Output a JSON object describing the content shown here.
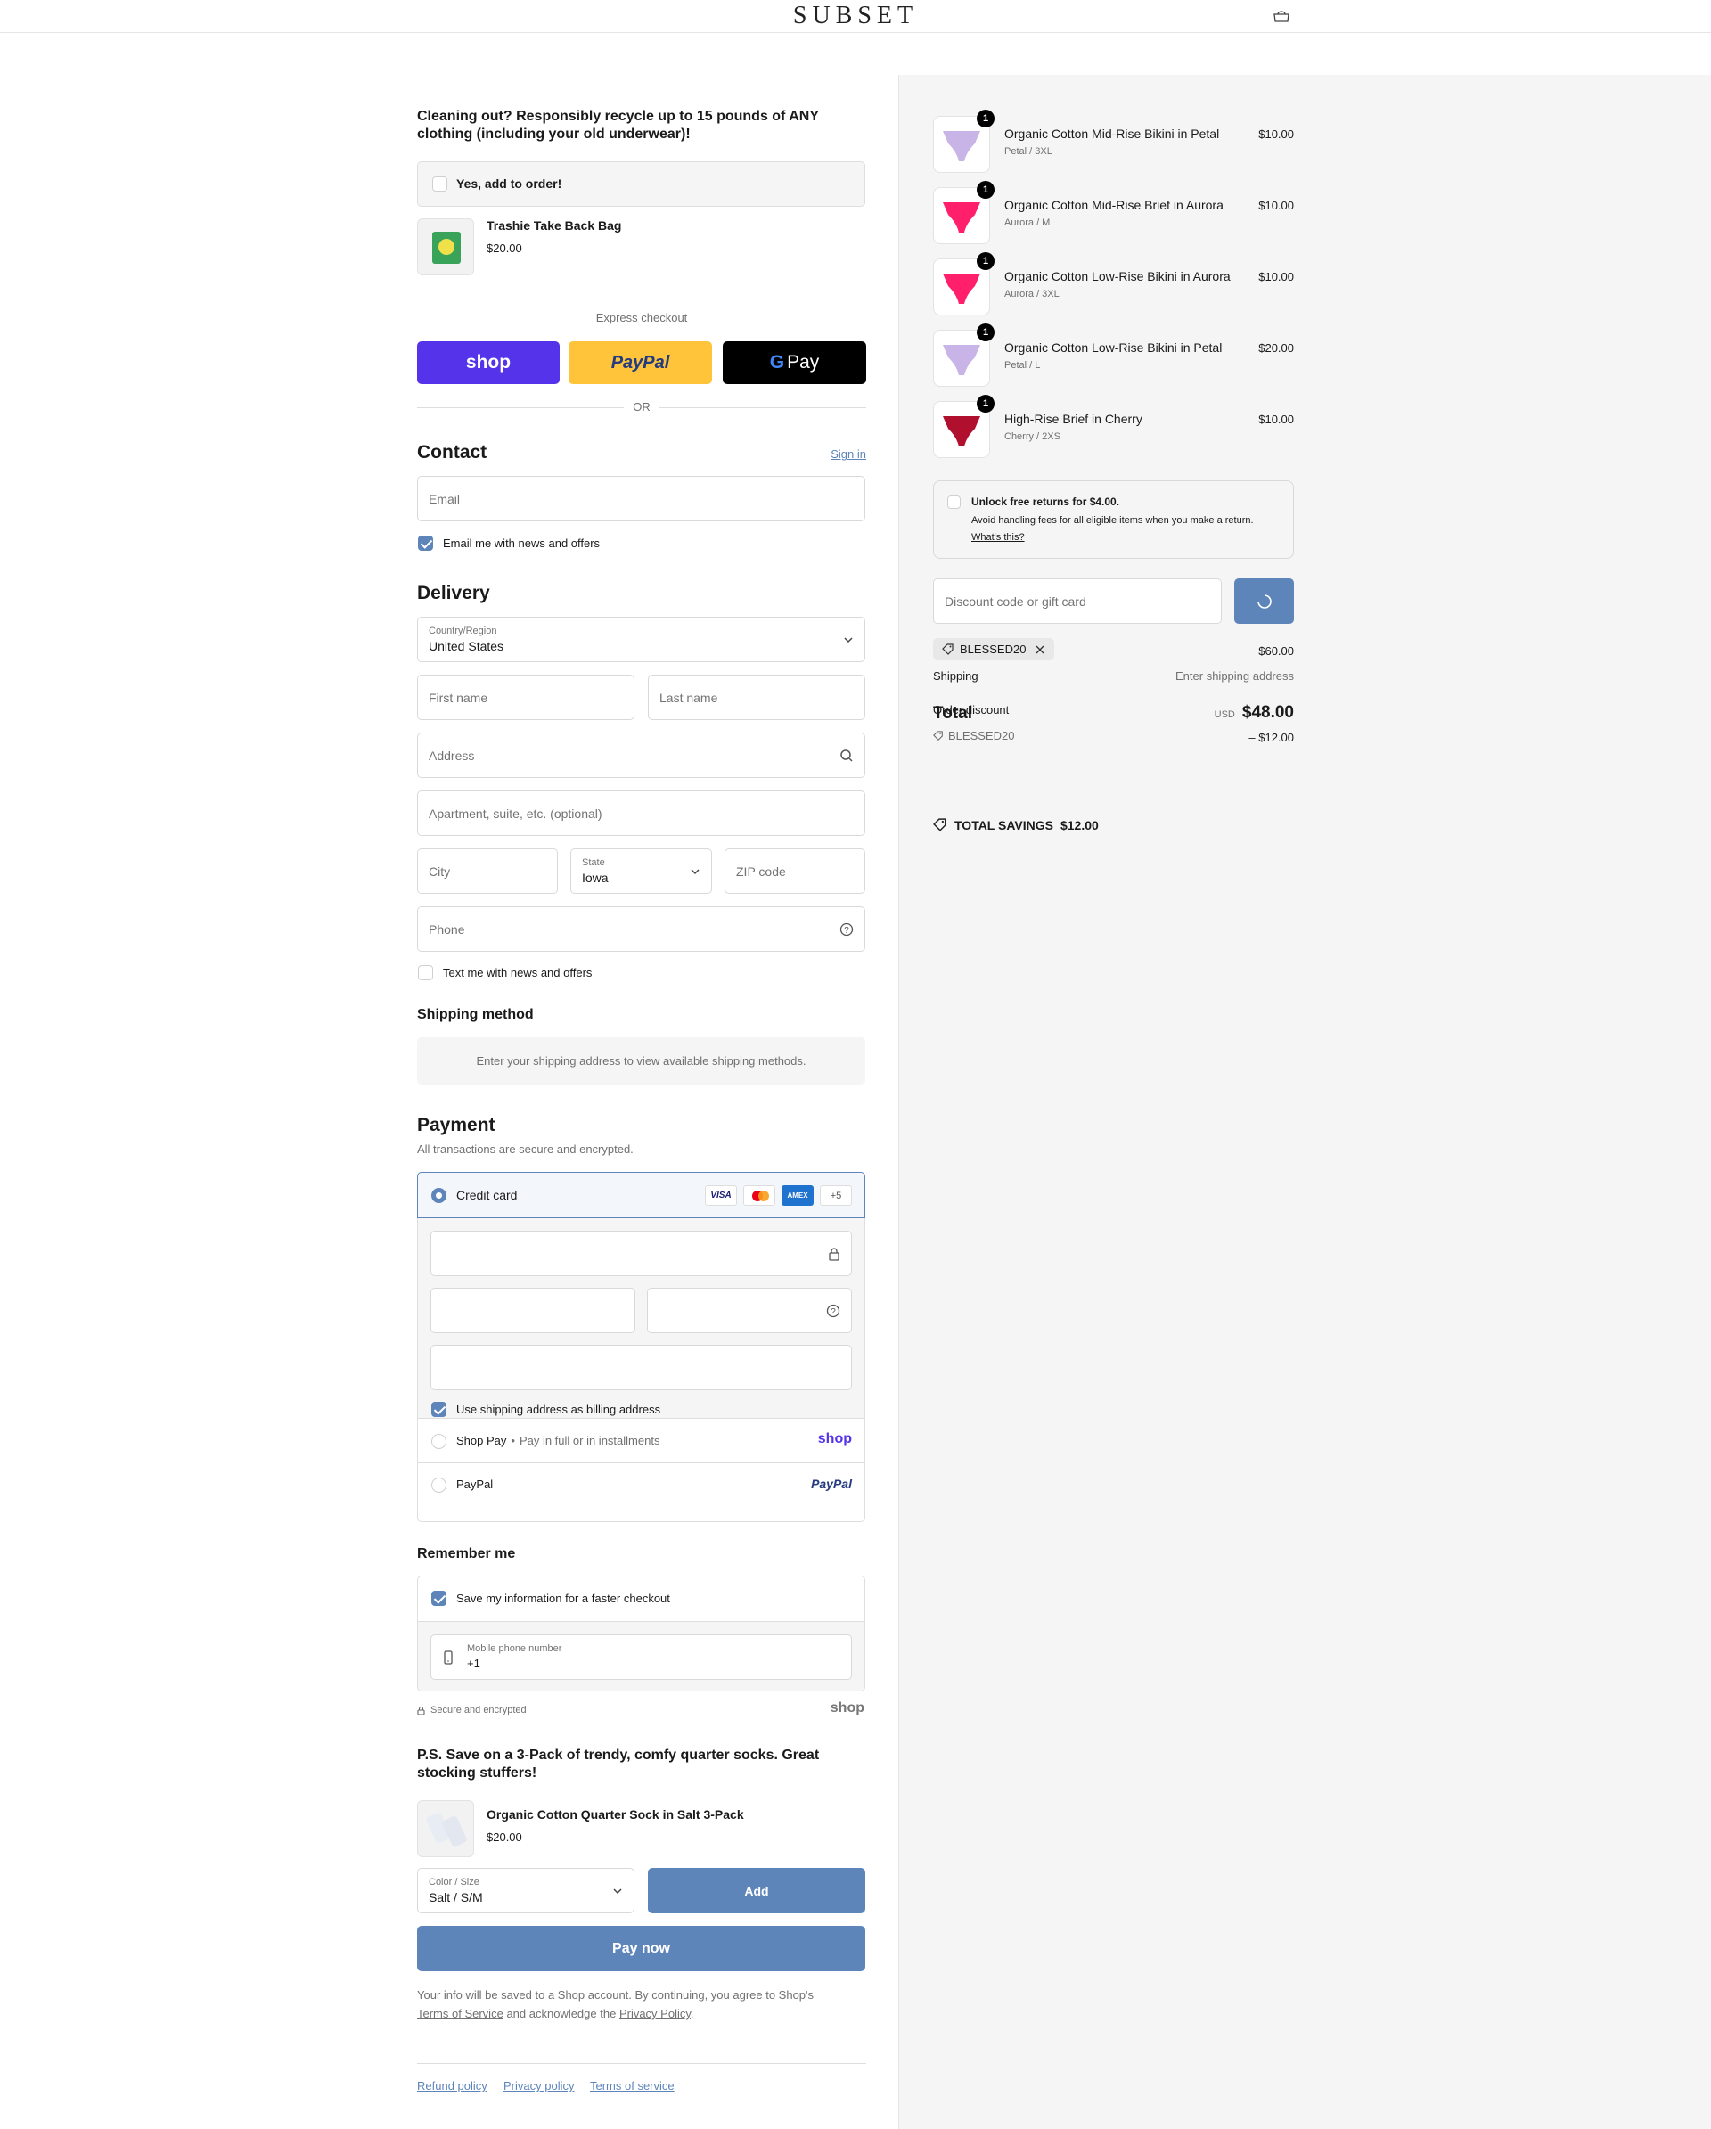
{
  "header": {
    "logo": "SUBSET",
    "cart_icon": "shopping-bag-icon"
  },
  "recycle": {
    "title": "Cleaning out? Responsibly recycle up to 15 pounds of ANY clothing (including your old underwear)!",
    "add_label": "Yes, add to order!",
    "product_name": "Trashie Take Back Bag",
    "product_price": "$20.00"
  },
  "express": {
    "label": "Express checkout",
    "shop_label": "shop",
    "paypal_label": "PayPal",
    "gpay_label": "Pay",
    "or_label": "OR"
  },
  "contact": {
    "title": "Contact",
    "sign_in": "Sign in",
    "email_placeholder": "Email",
    "email_news_label": "Email me with news and offers",
    "email_news_checked": true
  },
  "delivery": {
    "title": "Delivery",
    "country_label": "Country/Region",
    "country_value": "United States",
    "first_name_placeholder": "First name",
    "last_name_placeholder": "Last name",
    "address_placeholder": "Address",
    "apartment_placeholder": "Apartment, suite, etc. (optional)",
    "city_placeholder": "City",
    "state_label": "State",
    "state_value": "Iowa",
    "zip_placeholder": "ZIP code",
    "phone_placeholder": "Phone",
    "text_news_label": "Text me with news and offers",
    "text_news_checked": false
  },
  "shipping_method": {
    "title": "Shipping method",
    "message": "Enter your shipping address to view available shipping methods."
  },
  "payment": {
    "title": "Payment",
    "subtitle": "All transactions are secure and encrypted.",
    "credit_card_label": "Credit card",
    "card_brands": [
      "VISA",
      "Mastercard",
      "AMEX"
    ],
    "more_brands": "+5",
    "billing_label": "Use shipping address as billing address",
    "billing_checked": true,
    "shop_pay_label": "Shop Pay",
    "shop_pay_desc": "Pay in full or in installments",
    "shop_logo": "shop",
    "paypal_label": "PayPal",
    "paypal_logo": "PayPal"
  },
  "remember": {
    "title": "Remember me",
    "save_label": "Save my information for a faster checkout",
    "save_checked": true,
    "mobile_label": "Mobile phone number",
    "mobile_value": "+1",
    "secure_label": "Secure and encrypted",
    "shop_logo": "shop"
  },
  "upsell": {
    "title": "P.S. Save on a 3-Pack of trendy, comfy quarter socks. Great stocking stuffers!",
    "product_name": "Organic Cotton Quarter Sock in Salt 3-Pack",
    "product_price": "$20.00",
    "option_label": "Color / Size",
    "option_value": "Salt / S/M",
    "add_label": "Add"
  },
  "pay_now": "Pay now",
  "legal": {
    "text_before": "Your info will be saved to a Shop account. By continuing, you agree to Shop's",
    "terms": "Terms of Service",
    "middle": "and acknowledge the",
    "privacy": "Privacy Policy",
    "end": "."
  },
  "footer_links": [
    "Refund policy",
    "Privacy policy",
    "Terms of service"
  ],
  "cart": {
    "items": [
      {
        "name": "Organic Cotton Mid-Rise Bikini in Petal",
        "variant": "Petal / 3XL",
        "price": "$10.00",
        "qty": "1",
        "color": "#c8b4e6"
      },
      {
        "name": "Organic Cotton Mid-Rise Brief in Aurora",
        "variant": "Aurora / M",
        "price": "$10.00",
        "qty": "1",
        "color": "#ff1f6b"
      },
      {
        "name": "Organic Cotton Low-Rise Bikini in Aurora",
        "variant": "Aurora / 3XL",
        "price": "$10.00",
        "qty": "1",
        "color": "#ff1f6b"
      },
      {
        "name": "Organic Cotton Low-Rise Bikini in Petal",
        "variant": "Petal / L",
        "price": "$20.00",
        "qty": "1",
        "color": "#c8b4e6"
      },
      {
        "name": "High-Rise Brief in Cherry",
        "variant": "Cherry / 2XS",
        "price": "$10.00",
        "qty": "1",
        "color": "#b0102e"
      }
    ],
    "free_returns_title": "Unlock free returns for $4.00.",
    "free_returns_desc": "Avoid handling fees for all eligible items when you make a return.",
    "whats_this": "What's this?",
    "discount_placeholder": "Discount code or gift card",
    "applied_code": "BLESSED20",
    "subtotal": "$60.00",
    "shipping_label": "Shipping",
    "shipping_value": "Enter shipping address",
    "total_label": "Total",
    "order_discount_label": "Order discount",
    "currency": "USD",
    "total_value": "$48.00",
    "discount_code": "BLESSED20",
    "discount_value": "– $12.00",
    "total_savings_label": "TOTAL SAVINGS",
    "total_savings_value": "$12.00"
  }
}
